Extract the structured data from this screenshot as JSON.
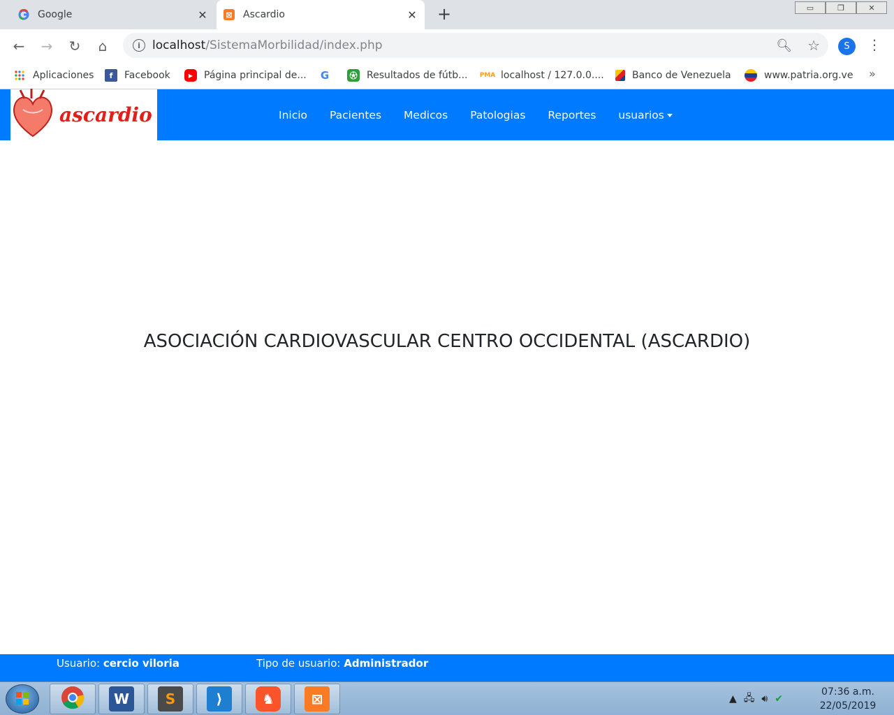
{
  "browser": {
    "tabs": [
      {
        "title": "Google",
        "favicon": "google-icon"
      },
      {
        "title": "Ascardio",
        "favicon": "xampp-icon"
      }
    ],
    "url_host": "localhost",
    "url_path": "/SistemaMorbilidad/index.php",
    "profile_initial": "S",
    "bookmarks": [
      {
        "label": "Aplicaciones",
        "icon": "apps-grid-icon"
      },
      {
        "label": "Facebook",
        "icon": "facebook-icon"
      },
      {
        "label": "Página principal de...",
        "icon": "youtube-icon"
      },
      {
        "label": "",
        "icon": "google-icon"
      },
      {
        "label": "Resultados de fútb...",
        "icon": "soccer-icon"
      },
      {
        "label": "localhost / 127.0.0....",
        "icon": "phpmyadmin-icon"
      },
      {
        "label": "Banco de Venezuela",
        "icon": "bank-icon"
      },
      {
        "label": "www.patria.org.ve",
        "icon": "patria-icon"
      }
    ],
    "more_bookmarks": "»"
  },
  "site": {
    "logo_text": "ascardio",
    "nav": [
      "Inicio",
      "Pacientes",
      "Medicos",
      "Patologias",
      "Reportes",
      "usuarios"
    ],
    "heading": "ASOCIACIÓN CARDIOVASCULAR CENTRO OCCIDENTAL (ASCARDIO)",
    "footer": {
      "user_label": "Usuario:",
      "user_value": "cercio viloria",
      "type_label": "Tipo de usuario:",
      "type_value": "Administrador"
    },
    "colors": {
      "primary": "#007bff",
      "logo_red": "#e0201b"
    }
  },
  "taskbar": {
    "apps": [
      "chrome-icon",
      "word-icon",
      "sublime-icon",
      "vscode-icon",
      "brave-icon",
      "xampp-icon"
    ],
    "time": "07:36 a.m.",
    "date": "22/05/2019"
  }
}
